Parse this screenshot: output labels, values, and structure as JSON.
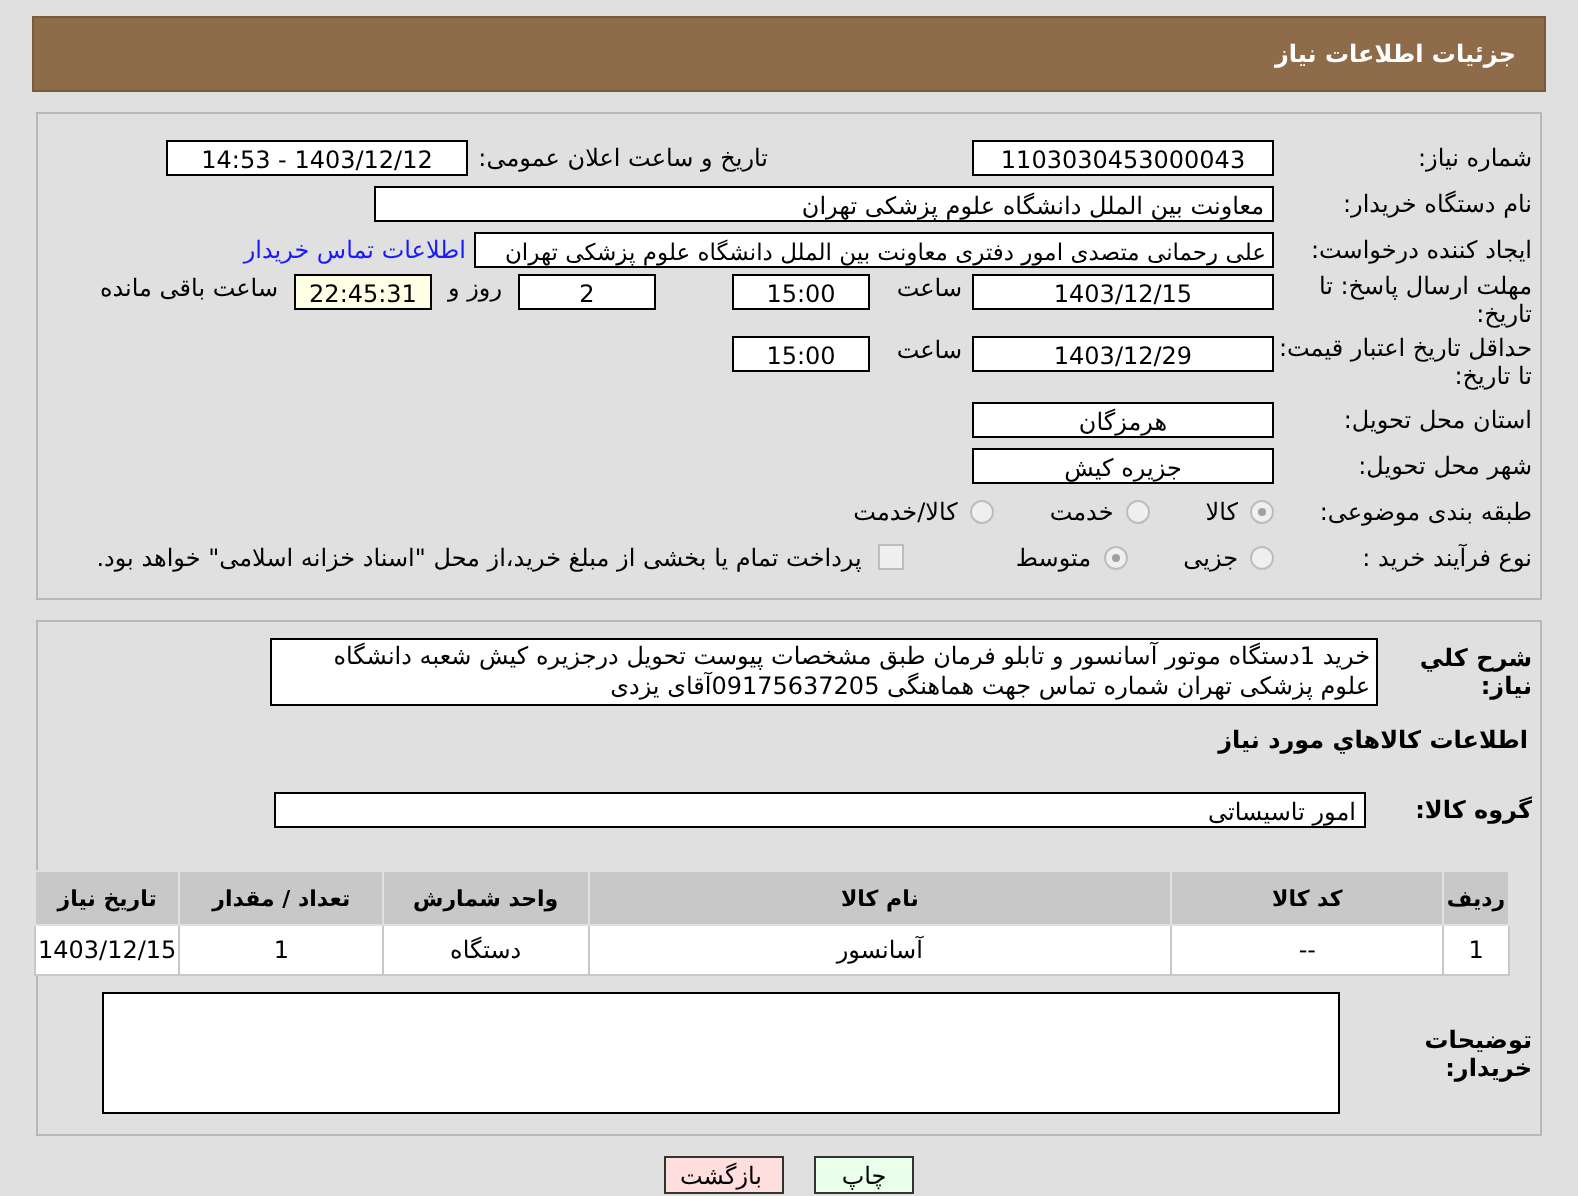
{
  "header": {
    "title": "جزئیات اطلاعات نیاز"
  },
  "need_number": {
    "label": "شماره نیاز:",
    "value": "1103030453000043"
  },
  "announce": {
    "label": "تاریخ و ساعت اعلان عمومی:",
    "value": "1403/12/12 - 14:53"
  },
  "buyer_org": {
    "label": "نام دستگاه خریدار:",
    "value": "معاونت بین الملل دانشگاه علوم پزشکی تهران"
  },
  "requester": {
    "label": "ایجاد کننده درخواست:",
    "value": "علی رحمانی متصدی امور دفتری معاونت بین الملل دانشگاه علوم پزشکی تهران",
    "link": "اطلاعات تماس خریدار"
  },
  "reply_deadline": {
    "label": "مهلت ارسال پاسخ: تا تاریخ:",
    "date": "1403/12/15",
    "time_label": "ساعت",
    "time": "15:00",
    "days": "2",
    "days_label": "روز و",
    "remaining": "22:45:31",
    "remaining_label": "ساعت باقی مانده"
  },
  "price_validity": {
    "label": "حداقل تاریخ اعتبار قیمت: تا تاریخ:",
    "date": "1403/12/29",
    "time_label": "ساعت",
    "time": "15:00"
  },
  "province": {
    "label": "استان محل تحویل:",
    "value": "هرمزگان"
  },
  "city": {
    "label": "شهر محل تحویل:",
    "value": "جزیره کیش"
  },
  "category": {
    "label": "طبقه بندی موضوعی:",
    "options": [
      {
        "label": "کالا",
        "selected": true
      },
      {
        "label": "خدمت",
        "selected": false
      },
      {
        "label": "کالا/خدمت",
        "selected": false
      }
    ]
  },
  "purchase_type": {
    "label": "نوع فرآیند خرید :",
    "options": [
      {
        "label": "جزیی",
        "selected": false
      },
      {
        "label": "متوسط",
        "selected": true
      }
    ],
    "checkbox": {
      "label": "پرداخت تمام یا بخشی از مبلغ خرید،از محل \"اسناد خزانه اسلامی\" خواهد بود.",
      "checked": false
    }
  },
  "description": {
    "label": "شرح کلي نياز:",
    "value": "خرید 1دستگاه موتور آسانسور و تابلو فرمان طبق مشخصات پیوست تحویل درجزیره کیش شعبه دانشگاه علوم پزشکی تهران شماره تماس جهت هماهنگی 09175637205آقای یزدی"
  },
  "goods_title": "اطلاعات کالاهاي مورد نياز",
  "goods_group": {
    "label": "گروه کالا:",
    "value": "امور تاسیساتی"
  },
  "table": {
    "columns": [
      "ردیف",
      "کد کالا",
      "نام کالا",
      "واحد شمارش",
      "تعداد / مقدار",
      "تاریخ نیاز"
    ],
    "rows": [
      [
        "1",
        "--",
        "آسانسور",
        "دستگاه",
        "1",
        "1403/12/15"
      ]
    ]
  },
  "buyer_notes": {
    "label": "توضیحات خریدار:"
  },
  "buttons": [
    {
      "label": "چاپ",
      "kind": "print"
    },
    {
      "label": "بازگشت",
      "kind": "back"
    }
  ]
}
